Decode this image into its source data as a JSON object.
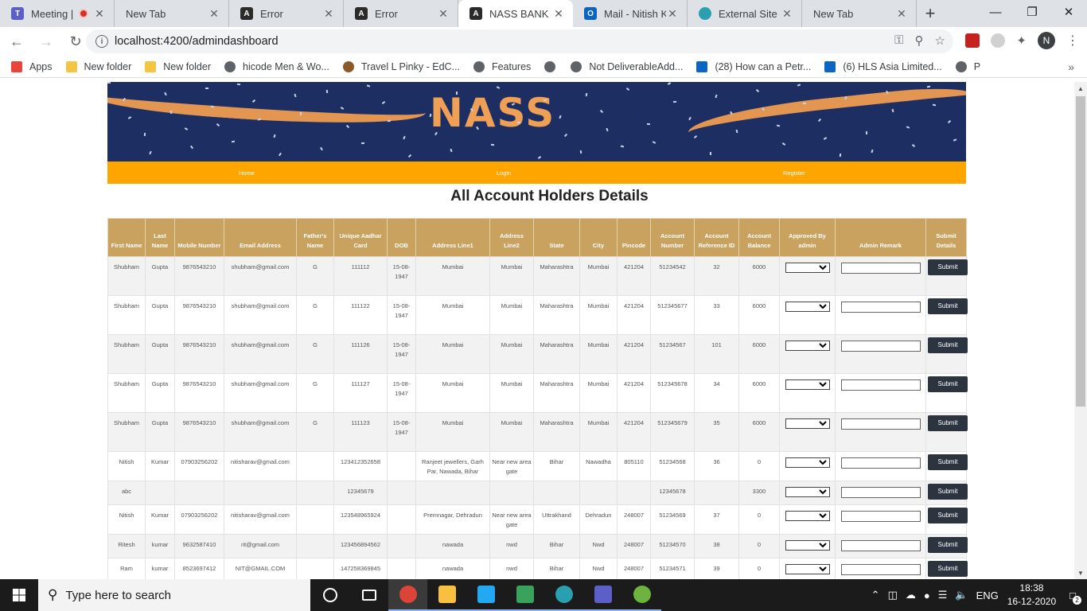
{
  "browser": {
    "tabs": [
      {
        "title": "Meeting |",
        "icon": "teams-icon",
        "color": "#5b5fc7",
        "glyph": "T"
      },
      {
        "title": "New Tab",
        "icon": "none",
        "color": "",
        "glyph": ""
      },
      {
        "title": "Error",
        "icon": "angular-icon",
        "color": "#2b2b2b",
        "glyph": "A"
      },
      {
        "title": "Error",
        "icon": "angular-icon",
        "color": "#2b2b2b",
        "glyph": "A"
      },
      {
        "title": "NASS BANK",
        "icon": "angular-icon",
        "color": "#2b2b2b",
        "glyph": "A"
      },
      {
        "title": "Mail - Nitish K",
        "icon": "outlook-icon",
        "color": "#0a64c2",
        "glyph": "O"
      },
      {
        "title": "External Site",
        "icon": "edge-icon",
        "color": "#2a9fb0",
        "glyph": ""
      },
      {
        "title": "New Tab",
        "icon": "none",
        "color": "",
        "glyph": ""
      }
    ],
    "url": "localhost:4200/admindashboard",
    "avatar_letter": "N",
    "bookmarks": [
      {
        "label": "Apps",
        "icon": "apps-grid-icon",
        "color": "#e8453c"
      },
      {
        "label": "New folder",
        "icon": "folder-icon",
        "color": "#f4c542"
      },
      {
        "label": "New folder",
        "icon": "folder-icon",
        "color": "#f4c542"
      },
      {
        "label": "hicode Men & Wo...",
        "icon": "globe-icon",
        "color": "#5f6368"
      },
      {
        "label": "Travel L Pinky - EdC...",
        "icon": "avatar-icon",
        "color": "#8b5a2b"
      },
      {
        "label": "Features",
        "icon": "globe-icon",
        "color": "#5f6368"
      },
      {
        "label": "",
        "icon": "globe-icon",
        "color": "#5f6368"
      },
      {
        "label": "Not DeliverableAdd...",
        "icon": "globe-icon",
        "color": "#5f6368"
      },
      {
        "label": "(28) How can a Petr...",
        "icon": "linkedin-icon",
        "color": "#0a66c2"
      },
      {
        "label": "(6) HLS Asia Limited...",
        "icon": "linkedin-icon",
        "color": "#0a66c2"
      },
      {
        "label": "P",
        "icon": "globe-icon",
        "color": "#5f6368"
      }
    ]
  },
  "page": {
    "banner_text": "NASS",
    "nav": {
      "home": "Home",
      "login": "Login",
      "register": "Register"
    },
    "title": "All Account Holders Details",
    "columns": [
      "First Name",
      "Last Name",
      "Mobile Number",
      "Email Address",
      "Father's Name",
      "Unique Aadhar Card",
      "DOB",
      "Address Line1",
      "Address Line2",
      "State",
      "City",
      "Pincode",
      "Account Number",
      "Account Reference ID",
      "Account Balance",
      "Approved By admin",
      "Admin Remark",
      "Submit Details"
    ],
    "submit_label": "Submit",
    "rows": [
      [
        "Shubham",
        "Gupta",
        "9876543210",
        "shubham@gmail.com",
        "G",
        "111112",
        "15-08-1947",
        "Mumbai",
        "Mumbai",
        "Maharashtra",
        "Mumbai",
        "421204",
        "51234542",
        "32",
        "6000"
      ],
      [
        "Shubham",
        "Gupta",
        "9876543210",
        "shubham@gmail.com",
        "G",
        "111122",
        "15-08-1947",
        "Mumbai",
        "Mumbai",
        "Maharashtra",
        "Mumbai",
        "421204",
        "512345677",
        "33",
        "6000"
      ],
      [
        "Shubham",
        "Gupta",
        "9876543210",
        "shubham@gmail.com",
        "G",
        "111126",
        "15-08-1947",
        "Mumbai",
        "Mumbai",
        "Maharashtra",
        "Mumbai",
        "421204",
        "51234567",
        "101",
        "6000"
      ],
      [
        "Shubham",
        "Gupta",
        "9876543210",
        "shubham@gmail.com",
        "G",
        "111127",
        "15-08-1947",
        "Mumbai",
        "Mumbai",
        "Maharashtra",
        "Mumbai",
        "421204",
        "512345678",
        "34",
        "6000"
      ],
      [
        "Shubham",
        "Gupta",
        "9876543210",
        "shubham@gmail.com",
        "G",
        "111123",
        "15-08-1947",
        "Mumbai",
        "Mumbai",
        "Maharashtra",
        "Mumbai",
        "421204",
        "512345679",
        "35",
        "6000"
      ],
      [
        "Nitish",
        "Kumar",
        "07903256202",
        "nitisharav@gmail.com",
        "",
        "123412352658",
        "",
        "Ranjeet jewellers, Garh Par, Nawada, Bihar",
        "Near new area gate",
        "Bihar",
        "Nawadha",
        "805110",
        "51234568",
        "36",
        "0"
      ],
      [
        "abc",
        "",
        "",
        "",
        "",
        "12345679",
        "",
        "",
        "",
        "",
        "",
        "",
        "12345678",
        "",
        "3300"
      ],
      [
        "Nitish",
        "Kumar",
        "07903256202",
        "nitisharav@gmail.com",
        "",
        "123548965924",
        "",
        "Premnagar, Dehradun",
        "Near new area gate",
        "Uttrakhand",
        "Dehradun",
        "248007",
        "51234569",
        "37",
        "0"
      ],
      [
        "Ritesh",
        "kumar",
        "9632587410",
        "rit@gmail.com",
        "",
        "123456894562",
        "",
        "nawada",
        "nwd",
        "Bihar",
        "Nwd",
        "248007",
        "51234570",
        "38",
        "0"
      ],
      [
        "Ram",
        "kumar",
        "8523697412",
        "NIT@GMAIL.COM",
        "",
        "147258369845",
        "",
        "nawada",
        "nwd",
        "Bihar",
        "Nwd",
        "248007",
        "51234571",
        "39",
        "0"
      ]
    ]
  },
  "taskbar": {
    "search_placeholder": "Type here to search",
    "apps": [
      "cortana-icon",
      "task-view-icon",
      "chrome-icon",
      "file-explorer-icon",
      "vscode-icon",
      "sticky-icon",
      "edge-icon",
      "teams-icon",
      "spring-icon"
    ],
    "language": "ENG",
    "time": "18:38",
    "date": "16-12-2020",
    "notification_count": "2"
  }
}
